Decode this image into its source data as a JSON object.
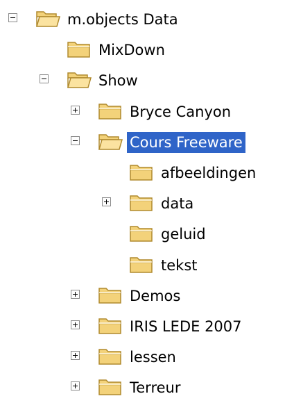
{
  "tree": {
    "colors": {
      "selection_bg": "#2f64c8",
      "selection_text": "#ffffff",
      "folder_fill": "#f3d27a",
      "folder_stroke": "#b08a2e"
    },
    "nodes": [
      {
        "label": "m.objects Data",
        "level": 0,
        "expander": "minus",
        "selected": false,
        "icon": "folder-open-icon"
      },
      {
        "label": "MixDown",
        "level": 1,
        "expander": "none",
        "selected": false,
        "icon": "folder-icon"
      },
      {
        "label": "Show",
        "level": 1,
        "expander": "minus",
        "selected": false,
        "icon": "folder-open-icon"
      },
      {
        "label": "Bryce Canyon",
        "level": 2,
        "expander": "plus",
        "selected": false,
        "icon": "folder-icon"
      },
      {
        "label": "Cours Freeware",
        "level": 2,
        "expander": "minus",
        "selected": true,
        "icon": "folder-open-icon"
      },
      {
        "label": "afbeeldingen",
        "level": 3,
        "expander": "none",
        "selected": false,
        "icon": "folder-icon"
      },
      {
        "label": "data",
        "level": 3,
        "expander": "plus",
        "selected": false,
        "icon": "folder-icon"
      },
      {
        "label": "geluid",
        "level": 3,
        "expander": "none",
        "selected": false,
        "icon": "folder-icon"
      },
      {
        "label": "tekst",
        "level": 3,
        "expander": "none",
        "selected": false,
        "icon": "folder-icon"
      },
      {
        "label": "Demos",
        "level": 2,
        "expander": "plus",
        "selected": false,
        "icon": "folder-icon"
      },
      {
        "label": "IRIS LEDE 2007",
        "level": 2,
        "expander": "plus",
        "selected": false,
        "icon": "folder-icon"
      },
      {
        "label": "lessen",
        "level": 2,
        "expander": "plus",
        "selected": false,
        "icon": "folder-icon"
      },
      {
        "label": "Terreur",
        "level": 2,
        "expander": "plus",
        "selected": false,
        "icon": "folder-icon"
      }
    ]
  }
}
